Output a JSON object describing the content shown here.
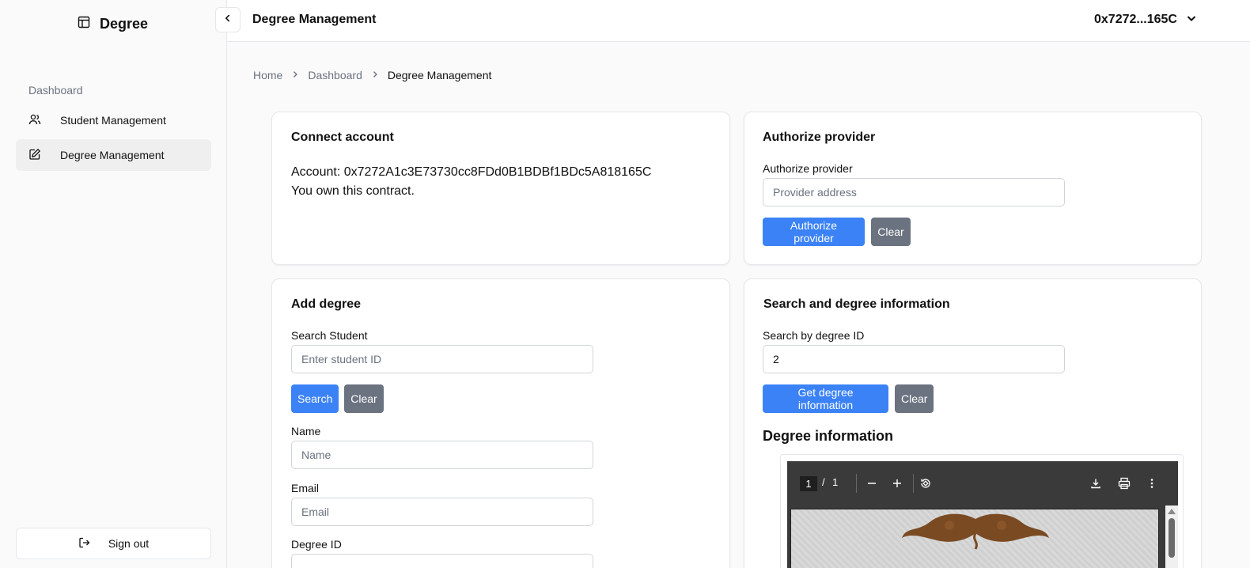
{
  "app": {
    "title": "Degree"
  },
  "sidebar": {
    "group_label": "Dashboard",
    "items": [
      {
        "label": "Student Management",
        "icon": "users-icon",
        "active": false
      },
      {
        "label": "Degree Management",
        "icon": "edit-icon",
        "active": true
      }
    ],
    "signout_label": "Sign out"
  },
  "header": {
    "title": "Degree Management",
    "account_short": "0x7272...165C"
  },
  "breadcrumb": [
    "Home",
    "Dashboard",
    "Degree Management"
  ],
  "connect_card": {
    "title": "Connect account",
    "account_line": "Account: 0x7272A1c3E73730cc8FDd0B1BDBf1BDc5A818165C",
    "owner_line": "You own this contract."
  },
  "authorize_card": {
    "title": "Authorize provider",
    "field_label": "Authorize provider",
    "placeholder": "Provider address",
    "submit_label": "Authorize provider",
    "clear_label": "Clear"
  },
  "add_degree_card": {
    "title": "Add degree",
    "search_label": "Search Student",
    "search_placeholder": "Enter student ID",
    "search_button": "Search",
    "clear_button": "Clear",
    "name_label": "Name",
    "name_placeholder": "Name",
    "email_label": "Email",
    "email_placeholder": "Email",
    "degree_id_label": "Degree ID"
  },
  "search_degree_card": {
    "title": "Search and degree information",
    "field_label": "Search by degree ID",
    "field_value": "2",
    "submit_label": "Get degree information",
    "clear_label": "Clear",
    "section_title": "Degree information"
  },
  "pdf_viewer": {
    "page_current": "1",
    "page_separator": "/",
    "page_total": "1"
  },
  "colors": {
    "primary": "#3b82f6",
    "secondary": "#6b7280",
    "pdf_toolbar": "#3a3a3a"
  }
}
